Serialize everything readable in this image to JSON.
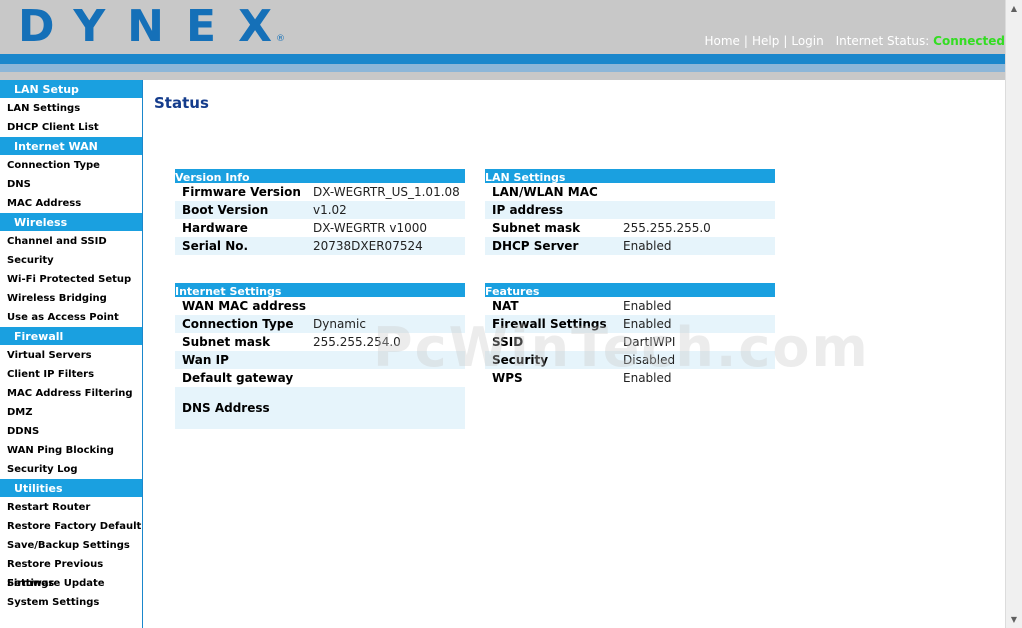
{
  "header": {
    "logo": "DYNEX",
    "logo_mark": "®",
    "nav": [
      "Home",
      "Help",
      "Login"
    ],
    "status_label": "Internet Status:",
    "status_value": "Connected",
    "colors": {
      "band": "#1a87cc",
      "status": "#33dd22"
    }
  },
  "sidebar": {
    "sections": [
      {
        "title": "LAN Setup",
        "items": [
          "LAN Settings",
          "DHCP Client List"
        ]
      },
      {
        "title": "Internet WAN",
        "items": [
          "Connection Type",
          "DNS",
          "MAC Address"
        ]
      },
      {
        "title": "Wireless",
        "items": [
          "Channel and SSID",
          "Security",
          "Wi-Fi Protected Setup",
          "Wireless Bridging",
          "Use as Access Point"
        ]
      },
      {
        "title": "Firewall",
        "items": [
          "Virtual Servers",
          "Client IP Filters",
          "MAC Address Filtering",
          "DMZ",
          "DDNS",
          "WAN Ping Blocking",
          "Security Log"
        ]
      },
      {
        "title": "Utilities",
        "items": [
          "Restart Router",
          "Restore Factory Default",
          "Save/Backup Settings",
          "Restore Previous Settings",
          "Firmware Update",
          "System Settings"
        ]
      }
    ]
  },
  "main": {
    "title": "Status",
    "watermark": "PcWinTech.com",
    "panels": {
      "version_info": {
        "title": "Version Info",
        "rows": [
          {
            "k": "Firmware Version",
            "v": "DX-WEGRTR_US_1.01.08"
          },
          {
            "k": "Boot Version",
            "v": "v1.02"
          },
          {
            "k": "Hardware",
            "v": "DX-WEGRTR v1000"
          },
          {
            "k": "Serial No.",
            "v": "20738DXER07524"
          }
        ]
      },
      "lan_settings": {
        "title": "LAN Settings",
        "rows": [
          {
            "k": "LAN/WLAN MAC",
            "v": ""
          },
          {
            "k": "IP address",
            "v": ""
          },
          {
            "k": "Subnet mask",
            "v": "255.255.255.0"
          },
          {
            "k": "DHCP Server",
            "v": "Enabled"
          }
        ]
      },
      "internet_settings": {
        "title": "Internet Settings",
        "rows": [
          {
            "k": "WAN MAC address",
            "v": ""
          },
          {
            "k": "Connection Type",
            "v": "Dynamic"
          },
          {
            "k": "Subnet mask",
            "v": "255.255.254.0"
          },
          {
            "k": "Wan IP",
            "v": ""
          },
          {
            "k": "Default gateway",
            "v": ""
          },
          {
            "k": "DNS Address",
            "v": ""
          }
        ]
      },
      "features": {
        "title": "Features",
        "rows": [
          {
            "k": "NAT",
            "v": "Enabled"
          },
          {
            "k": "Firewall Settings",
            "v": "Enabled"
          },
          {
            "k": "SSID",
            "v": "DartIWPI"
          },
          {
            "k": "Security",
            "v": "Disabled"
          },
          {
            "k": "WPS",
            "v": "Enabled"
          }
        ]
      }
    }
  }
}
